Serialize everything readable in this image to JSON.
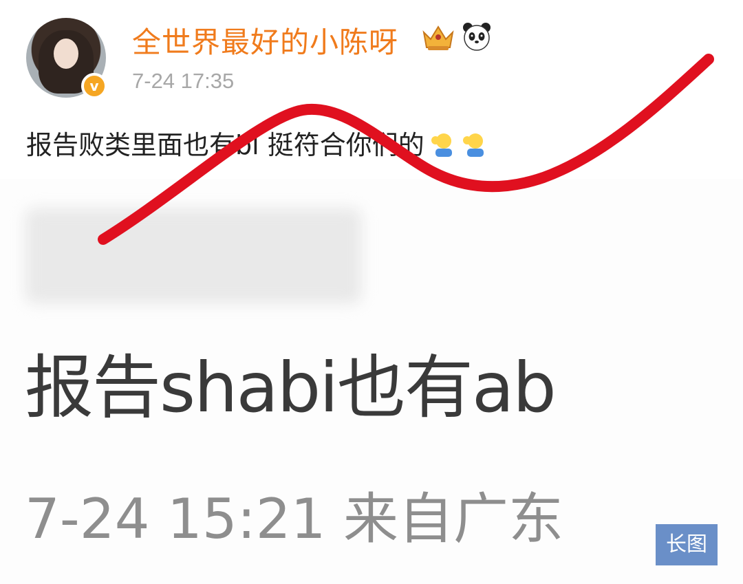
{
  "post": {
    "username": "全世界最好的小陈呀",
    "timestamp": "7-24 17:35",
    "text": "报告败类里面也有bl 挺符合你们的",
    "verified_badge": "v"
  },
  "screenshot_image": {
    "headline": "报告shabi也有ab",
    "meta": "7-24 15:21 来自广东"
  },
  "actions": {
    "long_image_label": "长图"
  },
  "colors": {
    "username": "#f07b1c",
    "scribble": "#e0101f",
    "long_image_button": "#6a8fc8"
  },
  "icons": [
    "crown-icon",
    "panda-icon",
    "salute-emoji-icon",
    "verified-badge-icon"
  ]
}
